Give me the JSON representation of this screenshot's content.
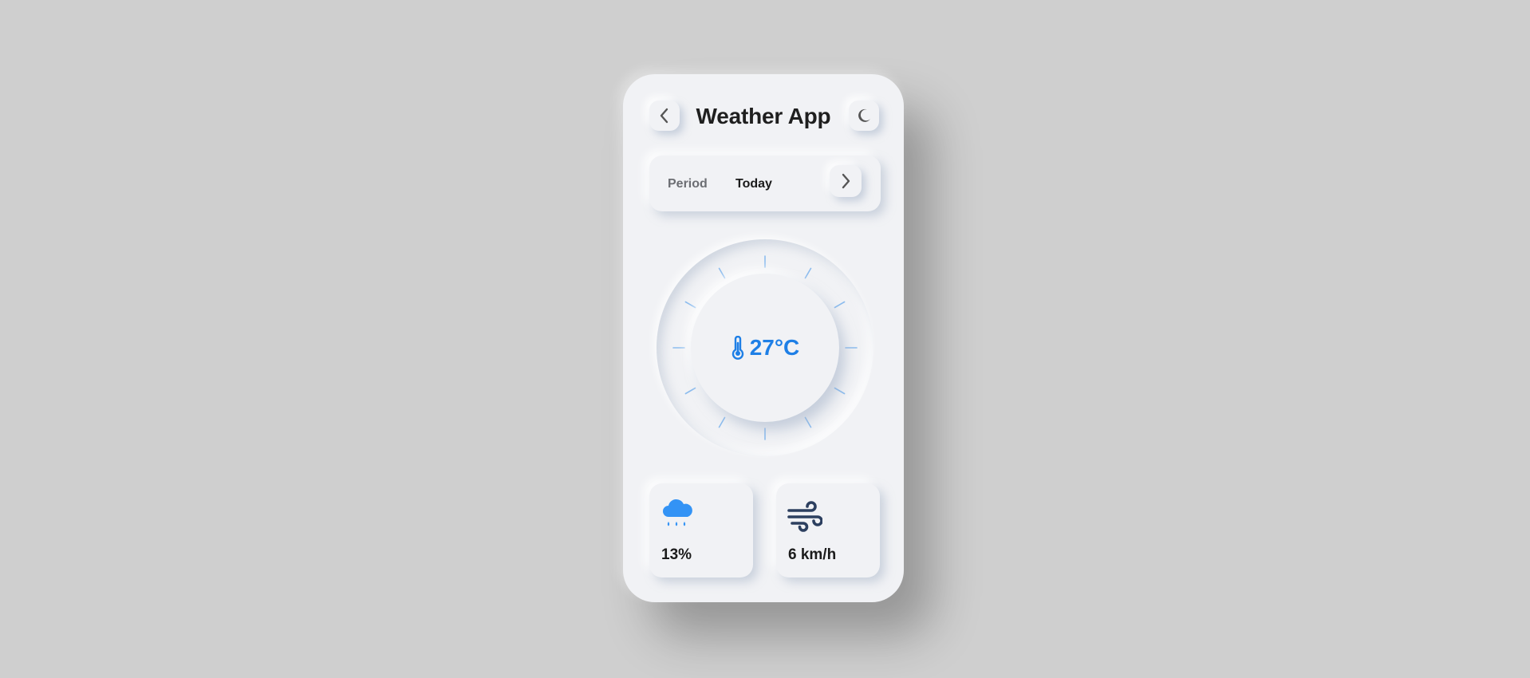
{
  "app": {
    "title": "Weather App"
  },
  "period": {
    "label": "Period",
    "value": "Today"
  },
  "temperature": {
    "value": "27°C"
  },
  "stats": {
    "rain": {
      "value": "13%",
      "icon": "cloud-rain-icon"
    },
    "wind": {
      "value": "6 km/h",
      "icon": "wind-icon"
    }
  },
  "colors": {
    "accent": "#1e7fe6",
    "tick": "#8cbcee",
    "background": "#cfcfcf",
    "surface": "#f1f2f5",
    "wind_icon": "#2c3f5f",
    "rain_icon": "#3393f5"
  }
}
